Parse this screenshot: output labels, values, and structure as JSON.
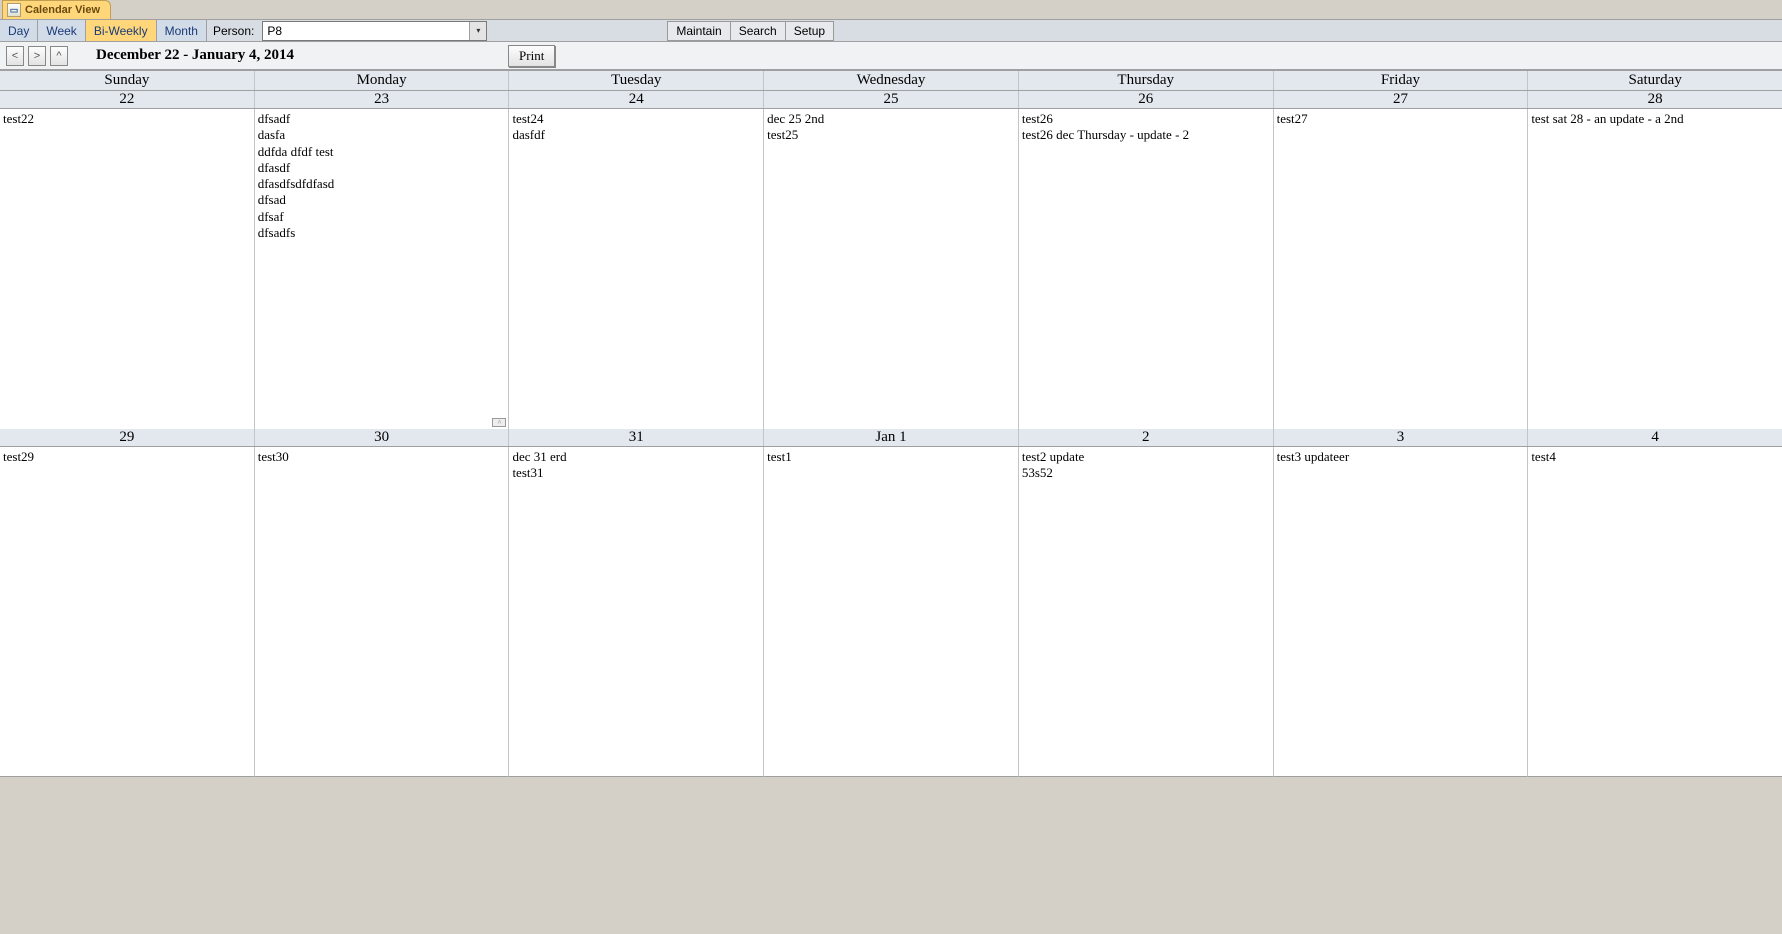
{
  "tab": {
    "title": "Calendar View"
  },
  "toolbar": {
    "views": [
      {
        "label": "Day",
        "active": false
      },
      {
        "label": "Week",
        "active": false
      },
      {
        "label": "Bi-Weekly",
        "active": true
      },
      {
        "label": "Month",
        "active": false
      }
    ],
    "person_label": "Person:",
    "person_value": "P8",
    "buttons": {
      "maintain": "Maintain",
      "search": "Search",
      "setup": "Setup"
    }
  },
  "nav": {
    "prev": "<",
    "next": ">",
    "up": "^",
    "title": "December 22 - January 4, 2014",
    "print": "Print"
  },
  "dow": [
    "Sunday",
    "Monday",
    "Tuesday",
    "Wednesday",
    "Thursday",
    "Friday",
    "Saturday"
  ],
  "weeks": [
    {
      "dates": [
        "22",
        "23",
        "24",
        "25",
        "26",
        "27",
        "28"
      ],
      "events": [
        [
          "test22"
        ],
        [
          "dfsadf",
          "dasfa",
          "ddfda dfdf test",
          "dfasdf",
          "dfasdfsdfdfasd",
          "dfsad",
          "dfsaf",
          "dfsadfs"
        ],
        [
          "test24",
          "dasfdf"
        ],
        [
          "dec 25 2nd",
          "test25"
        ],
        [
          "test26",
          "test26 dec Thursday - update - 2"
        ],
        [
          "test27"
        ],
        [
          "test sat 28 - an update - a 2nd"
        ]
      ],
      "grip_day_index": 1
    },
    {
      "dates": [
        "29",
        "30",
        "31",
        "Jan 1",
        "2",
        "3",
        "4"
      ],
      "events": [
        [
          "test29"
        ],
        [
          "test30"
        ],
        [
          "dec 31 erd",
          "test31"
        ],
        [
          "test1"
        ],
        [
          "test2 update",
          "53s52"
        ],
        [
          "test3 updateer"
        ],
        [
          "test4"
        ]
      ]
    }
  ]
}
